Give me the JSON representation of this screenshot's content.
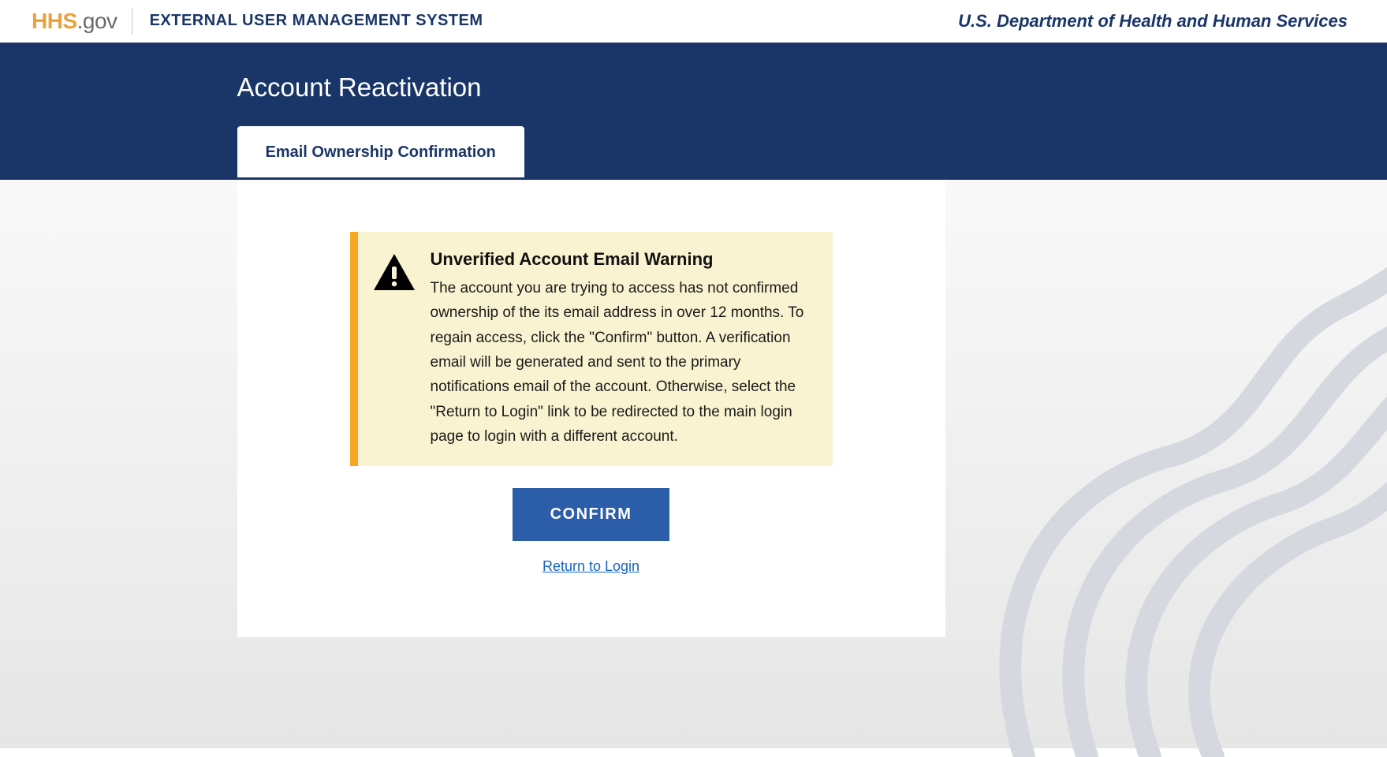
{
  "header": {
    "logo_hhs": "HHS",
    "logo_gov": ".gov",
    "system_title": "EXTERNAL USER MANAGEMENT SYSTEM",
    "department": "U.S. Department of Health and Human Services"
  },
  "banner": {
    "page_title": "Account Reactivation",
    "tab_label": "Email Ownership Confirmation"
  },
  "alert": {
    "title": "Unverified Account Email Warning",
    "body": "The account you are trying to access has not confirmed ownership of the its email address in over 12 months. To regain access, click the \"Confirm\" button. A verification email will be generated and sent to the primary notifications email of the account. Otherwise, select the \"Return to Login\" link to be redirected to the main login page to login with a different account."
  },
  "actions": {
    "confirm_label": "CONFIRM",
    "return_label": "Return to Login"
  },
  "colors": {
    "navy": "#1a3668",
    "accent_gold": "#f9a825",
    "button_blue": "#2b5da9",
    "link_blue": "#1565c0",
    "alert_bg": "#faf3d1"
  }
}
